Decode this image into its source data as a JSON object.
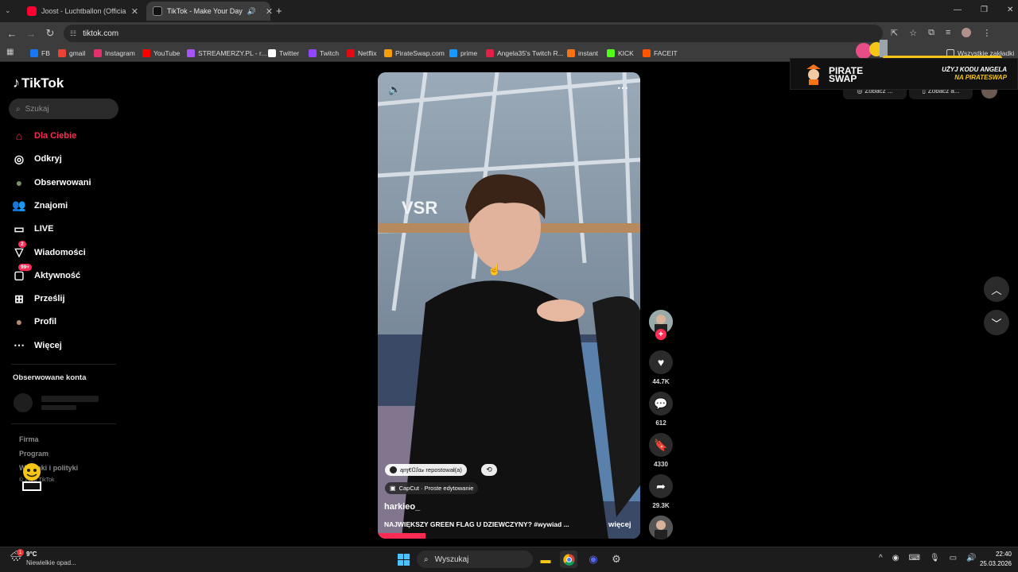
{
  "browser": {
    "tabs": [
      {
        "title": "Joost - Luchtballon (Official Vid",
        "color": "#ff0033"
      },
      {
        "title": "TikTok - Make Your Day",
        "color": "#ffffff"
      }
    ],
    "url": "tiktok.com",
    "bookmarks": [
      {
        "label": "FB",
        "color": "#1877f2"
      },
      {
        "label": "gmail",
        "color": "#ea4335"
      },
      {
        "label": "Instagram",
        "color": "#e1306c"
      },
      {
        "label": "YouTube",
        "color": "#ff0000"
      },
      {
        "label": "STREAMERZY.PL - r...",
        "color": "#a855f7"
      },
      {
        "label": "Twitter",
        "color": "#ffffff"
      },
      {
        "label": "Twitch",
        "color": "#9146ff"
      },
      {
        "label": "Netflix",
        "color": "#e50914"
      },
      {
        "label": "PirateSwap.com",
        "color": "#f59e0b"
      },
      {
        "label": "prime",
        "color": "#1a98ff"
      },
      {
        "label": "Angela35's Twitch R...",
        "color": "#e11d48"
      },
      {
        "label": "instant",
        "color": "#f97316"
      },
      {
        "label": "KICK",
        "color": "#53fc18"
      },
      {
        "label": "FACEIT",
        "color": "#ff5500"
      }
    ],
    "all_bookmarks": "Wszystkie zakładki"
  },
  "sidebar": {
    "logo": "TikTok",
    "search_placeholder": "Szukaj",
    "items": [
      {
        "label": "Dla Ciebie",
        "icon": "home-icon",
        "active": true
      },
      {
        "label": "Odkryj",
        "icon": "compass-icon"
      },
      {
        "label": "Obserwowani",
        "icon": "avatar-icon"
      },
      {
        "label": "Znajomi",
        "icon": "friends-icon"
      },
      {
        "label": "LIVE",
        "icon": "live-icon"
      },
      {
        "label": "Wiadomości",
        "icon": "message-icon",
        "badge": "2"
      },
      {
        "label": "Aktywność",
        "icon": "activity-icon",
        "badge": "99+"
      },
      {
        "label": "Prześlij",
        "icon": "upload-icon"
      },
      {
        "label": "Profil",
        "icon": "profile-icon"
      },
      {
        "label": "Więcej",
        "icon": "more-icon"
      }
    ],
    "followed_title": "Obserwowane konta",
    "footer": [
      "Firma",
      "Program",
      "Warunki i polityki",
      "© 2026 TikTok"
    ]
  },
  "video": {
    "repost_chip": "ąɱ€Ꮳꭍα𝓍 repostował(a)",
    "capcut_chip": "CapCut · Proste edytowanie",
    "author": "harkieo_",
    "caption": "NAJWIĘKSZY GREEN FLAG U DZIEWCZYNY? #wywiad ...",
    "more": "więcej"
  },
  "actions": {
    "likes": "44.7K",
    "comments": "612",
    "saves": "4330",
    "shares": "29.3K"
  },
  "ad": {
    "brand": "PIRATE SWAP",
    "line1": "UŻYJ KODU ANGELA",
    "line2": "NA PIRATESWAP",
    "chip1": "Zobacz ...",
    "chip2": "Zobacz a..."
  },
  "taskbar": {
    "weather_temp": "9°C",
    "weather_desc": "Niewielkie opad...",
    "search_label": "Wyszukaj",
    "time": "22:40",
    "date": "25.03.2026"
  },
  "colors": {
    "accent": "#fe2c55"
  }
}
